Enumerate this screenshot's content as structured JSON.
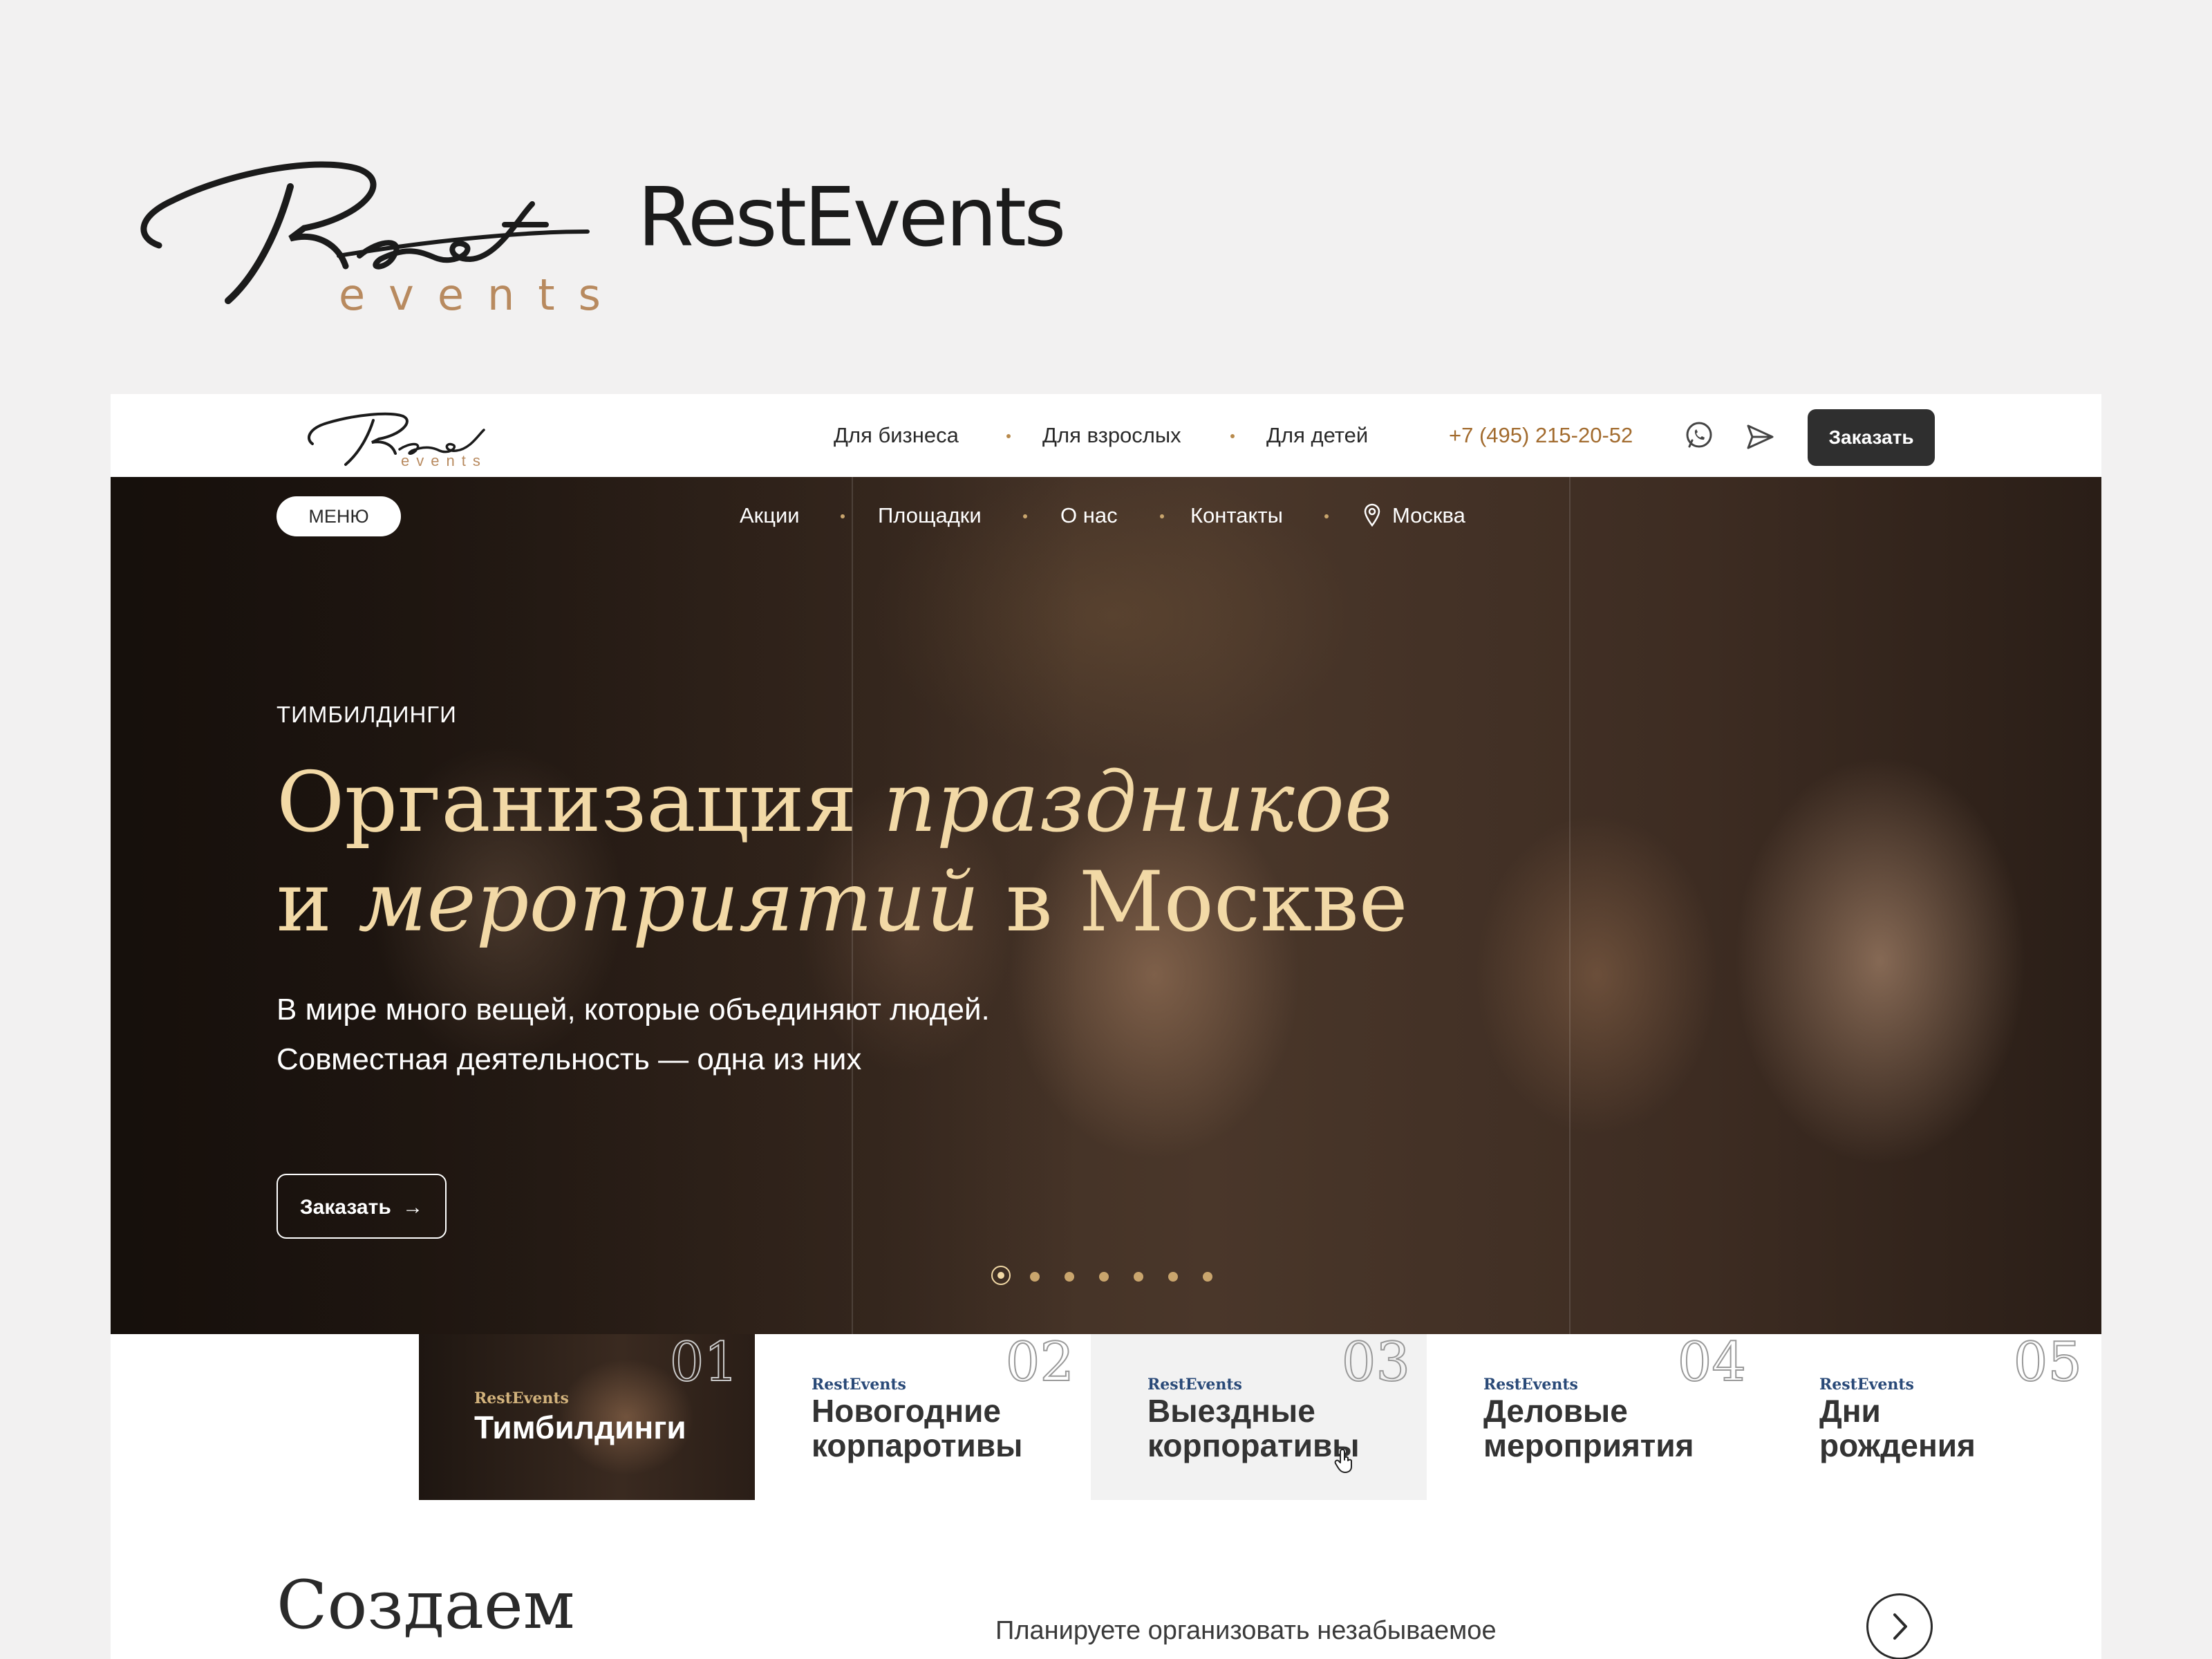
{
  "brand": {
    "logo_script": "Rest",
    "logo_sub": "events",
    "title": "RestEvents"
  },
  "topbar": {
    "logo_script": "Rest",
    "logo_sub": "events",
    "nav": [
      "Для бизнеса",
      "Для взрослых",
      "Для детей"
    ],
    "phone": "+7 (495) 215-20-52",
    "whatsapp_icon": "whatsapp-icon",
    "telegram_icon": "telegram-icon",
    "order_label": "Заказать"
  },
  "hero": {
    "menu_label": "МЕНЮ",
    "nav": [
      "Акции",
      "Площадки",
      "О нас",
      "Контакты"
    ],
    "city": "Москва",
    "eyebrow": "ТИМБИЛДИНГИ",
    "headline": {
      "part1": "Организация ",
      "part2_italic": "праздников",
      "part3": "и ",
      "part4_italic": "мероприятий",
      "part5": " в Москве"
    },
    "lead_line1": "В мире много вещей, которые объединяют людей.",
    "lead_line2": "Совместная деятельность — одна из них",
    "order_label": "Заказать",
    "slides_total": 7,
    "active_slide": 1
  },
  "categories": [
    {
      "num": "01",
      "brand": "RestEvents",
      "title_line1": "Тимбилдинги",
      "title_line2": "",
      "active": true
    },
    {
      "num": "02",
      "brand": "RestEvents",
      "title_line1": "Новогодние",
      "title_line2": "корпаротивы",
      "active": false
    },
    {
      "num": "03",
      "brand": "RestEvents",
      "title_line1": "Выездные",
      "title_line2": "корпоративы",
      "active": false,
      "hovered": true
    },
    {
      "num": "04",
      "brand": "RestEvents",
      "title_line1": "Деловые",
      "title_line2": "мероприятия",
      "active": false
    },
    {
      "num": "05",
      "brand": "RestEvents",
      "title_line1": "Дни",
      "title_line2": "рождения",
      "active": false
    }
  ],
  "section": {
    "title_line1": "Создаем",
    "text": "Планируете организовать незабываемое"
  },
  "colors": {
    "gold": "#f2d9a6",
    "accent_brown": "#a26b2e",
    "dark_button": "#2f2f2f",
    "page_bg": "#f2f1f1"
  }
}
